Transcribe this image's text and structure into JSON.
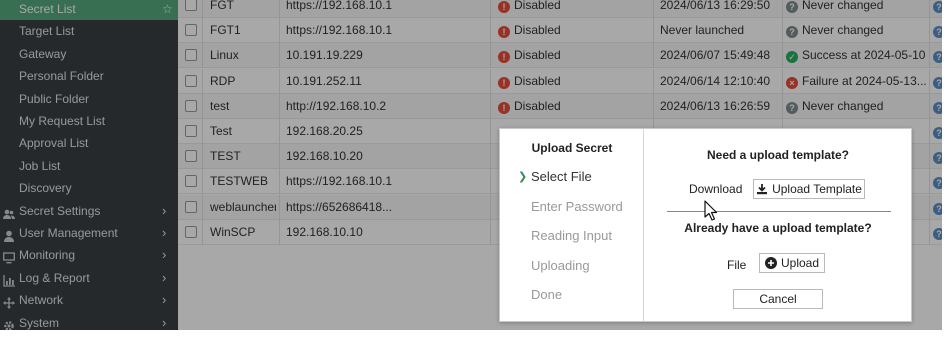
{
  "sidebar": {
    "items": [
      {
        "label": "Secret List",
        "active": true,
        "trailing": "star"
      },
      {
        "label": "Target List"
      },
      {
        "label": "Gateway"
      },
      {
        "label": "Personal Folder"
      },
      {
        "label": "Public Folder"
      },
      {
        "label": "My Request List"
      },
      {
        "label": "Approval List"
      },
      {
        "label": "Job List"
      },
      {
        "label": "Discovery"
      },
      {
        "label": "Secret Settings",
        "icon": "users-icon",
        "trailing": "chevron"
      },
      {
        "label": "User Management",
        "icon": "user-icon",
        "trailing": "chevron"
      },
      {
        "label": "Monitoring",
        "icon": "monitor-icon",
        "trailing": "chevron"
      },
      {
        "label": "Log & Report",
        "icon": "chart-icon",
        "trailing": "chevron"
      },
      {
        "label": "Network",
        "icon": "network-icon",
        "trailing": "chevron"
      },
      {
        "label": "System",
        "icon": "gear-icon",
        "trailing": "chevron"
      }
    ]
  },
  "table": {
    "rows": [
      {
        "name": "FGT",
        "host": "https://192.168.10.1",
        "status": "Disabled",
        "time": "2024/06/13 16:29:50",
        "result_kind": "unknown",
        "result": "Never changed"
      },
      {
        "name": "FGT1",
        "host": "https://192.168.10.1",
        "status": "Disabled",
        "time": "Never launched",
        "result_kind": "unknown",
        "result": "Never changed"
      },
      {
        "name": "Linux",
        "host": "10.191.19.229",
        "status": "Disabled",
        "time": "2024/06/07 15:49:48",
        "result_kind": "success",
        "result": "Success at 2024-05-10..."
      },
      {
        "name": "RDP",
        "host": "10.191.252.11",
        "status": "Disabled",
        "time": "2024/06/14 12:10:40",
        "result_kind": "failure",
        "result": "Failure at 2024-05-13..."
      },
      {
        "name": "test",
        "host": "http://192.168.10.2",
        "status": "Disabled",
        "time": "2024/06/13 16:26:59",
        "result_kind": "unknown",
        "result": "Never changed"
      },
      {
        "name": "Test",
        "host": "192.168.20.25"
      },
      {
        "name": "TEST",
        "host": "192.168.10.20"
      },
      {
        "name": "TESTWEB",
        "host": "https://192.168.10.1"
      },
      {
        "name": "weblauncher",
        "host": "https://652686418..."
      },
      {
        "name": "WinSCP",
        "host": "192.168.10.10"
      }
    ]
  },
  "modal": {
    "title": "Upload Secret",
    "steps": [
      "Select File",
      "Enter Password",
      "Reading Input",
      "Uploading",
      "Done"
    ],
    "current_step": 0,
    "template_heading": "Need a upload template?",
    "download_label": "Download",
    "upload_template_button": "Upload Template",
    "have_template_heading": "Already have a upload template?",
    "file_label": "File",
    "upload_button": "Upload",
    "cancel_button": "Cancel"
  },
  "colors": {
    "sidebar_bg": "#3a3f44",
    "sidebar_active": "#56a97e",
    "status_red": "#e74c3c",
    "status_green": "#27ae60",
    "status_gray": "#7f8c8d"
  }
}
